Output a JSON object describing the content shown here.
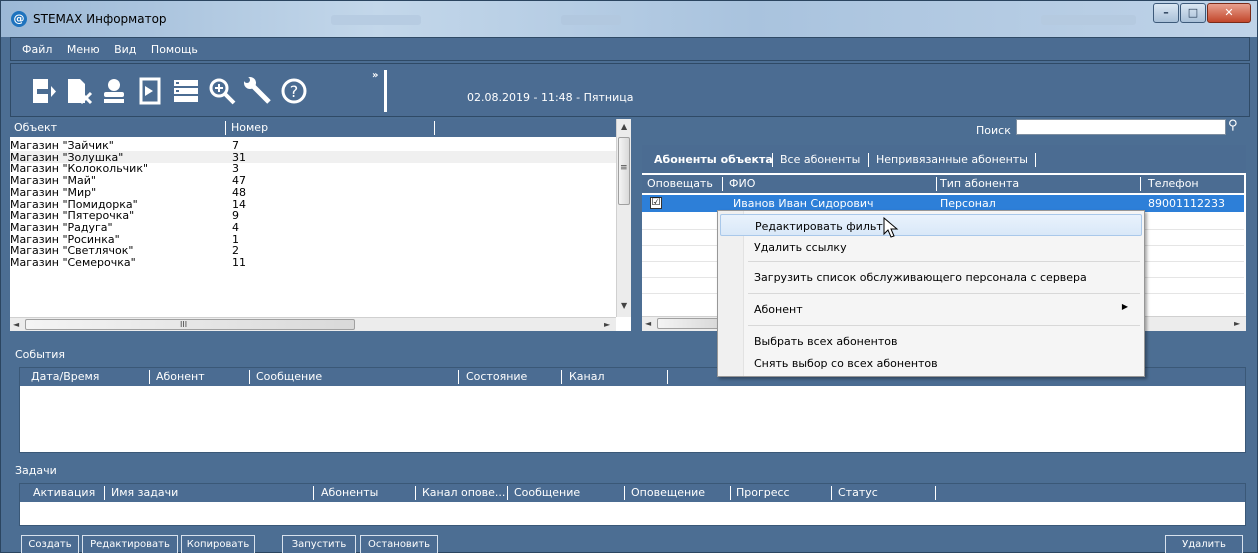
{
  "window": {
    "title": "STEMAX Информатор",
    "app_icon": "stemax-icon",
    "buttons": [
      "minimize",
      "maximize",
      "close"
    ]
  },
  "menu": [
    "Файл",
    "Меню",
    "Вид",
    "Помощь"
  ],
  "toolbar": {
    "icons": [
      "exit-icon",
      "document-edit-icon",
      "users-icon",
      "door-icon",
      "server-list-icon",
      "search-zoom-icon",
      "wrench-icon",
      "help-icon"
    ],
    "overflow": "»",
    "datetime": "02.08.2019 - 11:48 - Пятница"
  },
  "objects": {
    "columns": [
      "Объект",
      "Номер"
    ],
    "rows": [
      {
        "name": "Магазин \"Зайчик\"",
        "num": "7"
      },
      {
        "name": "Магазин \"Золушка\"",
        "num": "31"
      },
      {
        "name": "Магазин \"Колокольчик\"",
        "num": "3"
      },
      {
        "name": "Магазин \"Май\"",
        "num": "47"
      },
      {
        "name": "Магазин \"Мир\"",
        "num": "48"
      },
      {
        "name": "Магазин \"Помидорка\"",
        "num": "14"
      },
      {
        "name": "Магазин \"Пятерочка\"",
        "num": "9"
      },
      {
        "name": "Магазин \"Радуга\"",
        "num": "4"
      },
      {
        "name": "Магазин \"Росинка\"",
        "num": "1"
      },
      {
        "name": "Магазин \"Светлячок\"",
        "num": "2"
      },
      {
        "name": "Магазин \"Семерочка\"",
        "num": "11"
      }
    ],
    "scroll_mid": "III",
    "vscroll_mark": "≡"
  },
  "subscribers": {
    "search_label": "Поиск",
    "search_value": "",
    "tabs": [
      "Абоненты объекта",
      "Все абоненты",
      "Непривязанные абоненты"
    ],
    "columns": [
      "Оповещать",
      "ФИО",
      "Тип абонента",
      "Телефон"
    ],
    "row": {
      "checked": "☑",
      "name": "Иванов Иван Сидорович",
      "type": "Персонал",
      "phone": "89001112233"
    }
  },
  "context_menu": {
    "items": [
      "Редактировать фильтр",
      "Удалить ссылку",
      "Загрузить список обслуживающего персонала с сервера",
      "Абонент",
      "Выбрать всех абонентов",
      "Снять выбор со всех абонентов"
    ]
  },
  "events": {
    "label": "События",
    "columns": [
      "Дата/Время",
      "Абонент",
      "Сообщение",
      "Состояние",
      "Канал"
    ]
  },
  "tasks": {
    "label": "Задачи",
    "columns": [
      "Активация",
      "Имя задачи",
      "Абоненты",
      "Канал опове...",
      "Сообщение",
      "Оповещение",
      "Прогресс",
      "Статус"
    ]
  },
  "buttons": {
    "create": "Создать",
    "edit": "Редактировать",
    "copy": "Копировать",
    "start": "Запустить",
    "stop": "Остановить",
    "delete": "Удалить"
  }
}
